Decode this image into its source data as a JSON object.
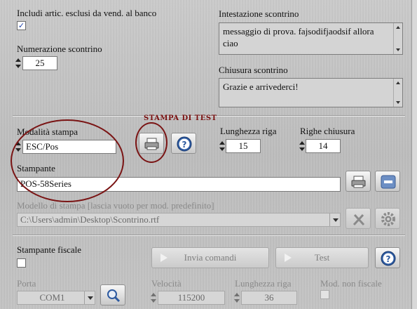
{
  "top": {
    "include_excluded": {
      "label": "Includi artic. esclusi da vend. al banco",
      "checked": true,
      "check_glyph": "✓"
    },
    "numerazione": {
      "label": "Numerazione scontrino",
      "value": "25"
    },
    "intestazione": {
      "label": "Intestazione scontrino",
      "value": "messaggio di prova. fajsodifjaodsif allora ciao"
    },
    "chiusura": {
      "label": "Chiusura scontrino",
      "value": "Grazie e arrivederci!"
    }
  },
  "print": {
    "annotation": "STAMPA DI TEST",
    "modalita": {
      "label": "Modalità stampa",
      "value": "ESC/Pos"
    },
    "lunghezza_riga": {
      "label": "Lunghezza riga",
      "value": "15"
    },
    "righe_chiusura": {
      "label": "Righe chiusura",
      "value": "14"
    },
    "stampante": {
      "label": "Stampante",
      "value": "POS-58Series"
    },
    "modello": {
      "label": "Modello di stampa [lascia vuoto per mod. predefinito]",
      "value": "C:\\Users\\admin\\Desktop\\Scontrino.rtf"
    },
    "help_glyph": "?",
    "remove_glyph": "—"
  },
  "fiscal": {
    "label": "Stampante fiscale",
    "checked": false,
    "invia_label": "Invia comandi",
    "test_label": "Test",
    "porta": {
      "label": "Porta",
      "value": "COM1"
    },
    "velocita": {
      "label": "Velocità",
      "value": "115200"
    },
    "lunghezza_riga": {
      "label": "Lunghezza riga",
      "value": "36"
    },
    "mod_non_fiscale": {
      "label": "Mod. non fiscale",
      "checked": false
    }
  },
  "colors": {
    "accent_blue": "#2d5aa0",
    "annotation_red": "#7a1414",
    "panel": "#c4c4c4"
  },
  "icons": [
    "printer-icon",
    "help-icon",
    "remove-icon",
    "tools-icon",
    "settings-gear-icon",
    "search-icon",
    "play-icon"
  ]
}
